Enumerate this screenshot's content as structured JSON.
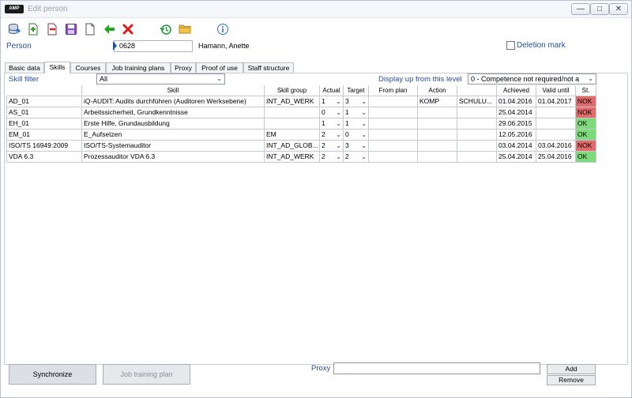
{
  "window": {
    "logo": "AMP",
    "title": "Edit person",
    "controls": {
      "minimize": "—",
      "maximize": "□",
      "close": "✕"
    }
  },
  "toolbar": {
    "icons": [
      "database-icon",
      "new-record-icon",
      "delete-record-icon",
      "save-icon",
      "document-icon",
      "back-arrow-icon",
      "cancel-icon",
      "history-icon",
      "folder-icon",
      "info-icon"
    ]
  },
  "person": {
    "label": "Person",
    "id": "0628",
    "name": "Hamann, Anette",
    "deletion_mark_label": "Deletion mark"
  },
  "tabs": [
    "Basic data",
    "Skills",
    "Courses",
    "Job training plans",
    "Proxy",
    "Proof of use",
    "Staff structure"
  ],
  "active_tab": "Skills",
  "filter": {
    "skill_filter_label": "Skill filter",
    "skill_filter_value": "All",
    "display_label": "Display up from this level",
    "display_value": "0 - Competence not required/not a"
  },
  "grid": {
    "columns": [
      "",
      "Skill",
      "Skill group",
      "Actual",
      "Target",
      "From plan",
      "Action",
      "",
      "Achieved",
      "Valid until",
      "St."
    ],
    "rows": [
      {
        "code": "AD_01",
        "skill": "iQ-AUDIT: Audits durchführen (Auditoren Werksebene)",
        "group": "INT_AD_WERK",
        "actual": "1",
        "target": "3",
        "from_plan": "",
        "action": "KOMP",
        "action2": "SCHULU...",
        "achieved": "01.04.2016",
        "valid_until": "01.04.2017",
        "status": "NOK"
      },
      {
        "code": "AS_01",
        "skill": "Arbeitssicherheit, Grundkenntnisse",
        "group": "",
        "actual": "0",
        "target": "1",
        "from_plan": "",
        "action": "",
        "action2": "",
        "achieved": "25.04.2014",
        "valid_until": "",
        "status": "NOK"
      },
      {
        "code": "EH_01",
        "skill": "Erste Hilfe, Grundausbildung",
        "group": "",
        "actual": "1",
        "target": "1",
        "from_plan": "",
        "action": "",
        "action2": "",
        "achieved": "29.06.2015",
        "valid_until": "",
        "status": "OK"
      },
      {
        "code": "EM_01",
        "skill": "E_Aufsetzen",
        "group": "EM",
        "actual": "2",
        "target": "0",
        "from_plan": "",
        "action": "",
        "action2": "",
        "achieved": "12.05.2016",
        "valid_until": "",
        "status": "OK"
      },
      {
        "code": "ISO/TS 16949:2009",
        "skill": "ISO/TS-Systemauditor",
        "group": "INT_AD_GLOB...",
        "actual": "2",
        "target": "3",
        "from_plan": "",
        "action": "",
        "action2": "",
        "achieved": "03.04.2014",
        "valid_until": "03.04.2016",
        "status": "NOK"
      },
      {
        "code": "VDA 6.3",
        "skill": "Prozessauditor VDA 6.3",
        "group": "INT_AD_WERK",
        "actual": "2",
        "target": "2",
        "from_plan": "",
        "action": "",
        "action2": "",
        "achieved": "25.04.2014",
        "valid_until": "25.04.2016",
        "status": "OK"
      }
    ]
  },
  "bottom": {
    "synchronize": "Synchronize",
    "job_training_plan": "Job training plan",
    "proxy_label": "Proxy",
    "proxy_value": "",
    "add": "Add",
    "remove": "Remove"
  },
  "colors": {
    "ok": "#7dd97a",
    "nok": "#e36a6a",
    "label_blue": "#2b4c9a"
  }
}
